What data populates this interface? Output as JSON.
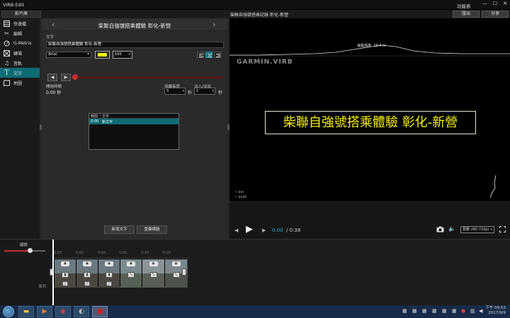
{
  "window": {
    "title": "VIRB Edit",
    "menu_label": "功能表",
    "minimize": "—",
    "maximize": "☐",
    "close": "✕"
  },
  "top": {
    "library_tab": "影片庫",
    "video_title": "柴聯自強號搭乘記錄 彰化-新營",
    "exit_button": "匯出",
    "share_button": "分享"
  },
  "sidebar": {
    "items": [
      {
        "label": "快速檔",
        "icon": "film-icon"
      },
      {
        "label": "編輯",
        "icon": "scissors-icon"
      },
      {
        "label": "G-Metrix",
        "icon": "gmetrix-icon"
      },
      {
        "label": "轉場",
        "icon": "transition-icon"
      },
      {
        "label": "音軌",
        "icon": "music-icon"
      },
      {
        "label": "文字",
        "icon": "text-icon"
      },
      {
        "label": "地圖",
        "icon": "map-icon"
      }
    ],
    "active_index": 5
  },
  "panel": {
    "title": "柴聯自強號搭乘體驗 彰化-新營",
    "prev": "‹",
    "next": "›",
    "text_label": "文字",
    "text_value": "柴聯自強號搭乘體驗 彰化-新營",
    "font": "Arial",
    "font_size": "100",
    "text_color": "#f5f200",
    "start_time_label": "開始時間",
    "start_time_value": "0:00 秒",
    "duration_label": "持續長度",
    "duration_value": "5",
    "duration_unit": "秒",
    "fade_label": "淡入/淡出",
    "fade_value": "1",
    "fade_unit": "秒",
    "table": {
      "col_time": "時間",
      "col_text": "文字",
      "rows": [
        {
          "time": "0:00",
          "text": "新文字"
        }
      ]
    },
    "add_text_button": "新增文字",
    "overlay_title_button": "重疊標題"
  },
  "video": {
    "elevation_label": "海拔高度: 25.4 m",
    "brand": "GARMIN.VIRB",
    "overlay_text": "柴聯自強號搭乘體驗 彰化-新營",
    "legend_1": "— km",
    "legend_2": "— km/h",
    "time_current": "0:00",
    "time_total": "/ 0:38",
    "quality": "預覽 (HD 720p)"
  },
  "timeline": {
    "zoom_label": "縮放",
    "track_label": "影片",
    "ticks": [
      "0:03",
      "0:02",
      "0:04",
      "0:06",
      "0:10",
      "0:20"
    ]
  },
  "taskbar": {
    "time": "下午 09:53",
    "date": "2017/9/9"
  },
  "colors": {
    "accent": "#0d6b74",
    "playhead_red": "#c33030",
    "overlay_yellow": "#f5ef00",
    "time_blue": "#29aac5"
  }
}
